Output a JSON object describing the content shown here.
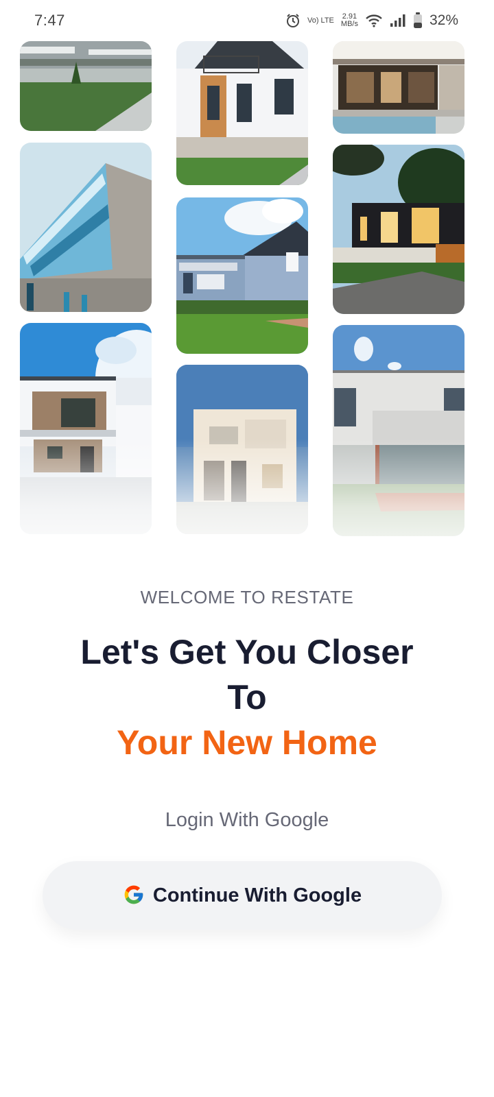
{
  "status_bar": {
    "time": "7:47",
    "volte_label": "Vo) LTE",
    "speed_value": "2.91",
    "speed_unit": "MB/s",
    "battery_percent": "32%"
  },
  "collage": {
    "tiles": [
      {
        "name": "apartment-block"
      },
      {
        "name": "white-gabled-house"
      },
      {
        "name": "modern-villa-pool"
      },
      {
        "name": "angular-glass-building"
      },
      {
        "name": "blue-suburban-house"
      },
      {
        "name": "dark-modern-house"
      },
      {
        "name": "white-two-story-house"
      },
      {
        "name": "cream-cube-house"
      },
      {
        "name": "flat-roof-white-house"
      }
    ]
  },
  "welcome": {
    "eyebrow": "WELCOME TO RESTATE",
    "headline_line1": "Let's Get You Closer",
    "headline_line2": "To",
    "headline_accent": "Your New Home",
    "login_label": "Login With Google"
  },
  "google_button": {
    "label": "Continue With Google",
    "icon": "google-g-icon"
  },
  "colors": {
    "primary_text": "#191d31",
    "muted_text": "#666876",
    "accent": "#f26414",
    "button_bg": "#f2f3f5"
  }
}
